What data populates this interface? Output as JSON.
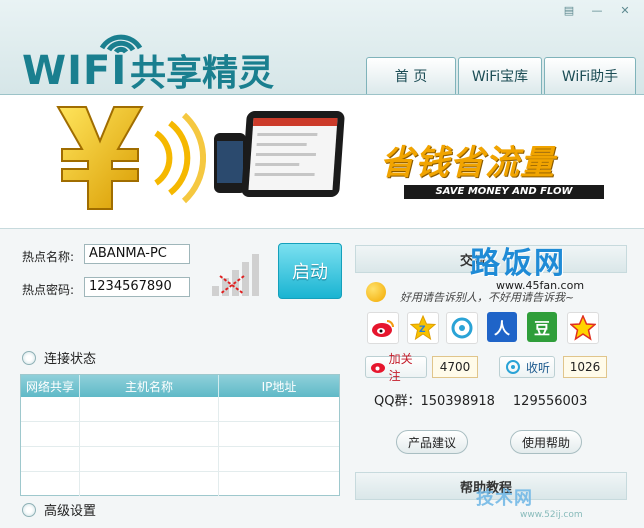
{
  "app": {
    "logo_wifi": "WIFI",
    "logo_cn": "共享精灵"
  },
  "tabs": [
    {
      "label": "首 页"
    },
    {
      "label": "WiFi宝库"
    },
    {
      "label": "WiFi助手"
    }
  ],
  "banner": {
    "slogan_cn": "省钱省流量",
    "slogan_en": "SAVE MONEY AND FLOW"
  },
  "hotspot": {
    "name_label": "热点名称:",
    "name_value": "ABANMA-PC",
    "password_label": "热点密码:",
    "password_value": "1234567890",
    "start_label": "启动"
  },
  "connection": {
    "section_label": "连接状态",
    "columns": [
      "网络共享",
      "主机名称",
      "IP地址"
    ],
    "rows": [
      [
        "",
        "",
        ""
      ],
      [
        "",
        "",
        ""
      ],
      [
        "",
        "",
        ""
      ],
      [
        "",
        "",
        ""
      ]
    ]
  },
  "advanced": {
    "section_label": "高级设置"
  },
  "exchange": {
    "title": "交流",
    "note": "好用请告诉别人，不好用请告诉我~",
    "social_icons": [
      "weibo-icon",
      "qzone-icon",
      "tencent-weibo-icon",
      "renren-icon",
      "douban-icon",
      "pengyou-icon"
    ],
    "follow_label": "加关注",
    "follow_count": "4700",
    "collect_label": "收听",
    "collect_count": "1026",
    "qq_group_label": "QQ群：150398918",
    "qq_group_2": "129556003",
    "feedback_button": "产品建议",
    "help_button": "使用帮助"
  },
  "help": {
    "title": "帮助教程"
  },
  "watermark": {
    "site_cn": "路饭网",
    "site_url": "www.45fan.com",
    "site2_cn": "技术网",
    "site2_url": "www.52ij.com"
  },
  "colors": {
    "accent": "#1a7f8f",
    "start_button": "#1ab4d2",
    "slogan": "#f1a400"
  }
}
